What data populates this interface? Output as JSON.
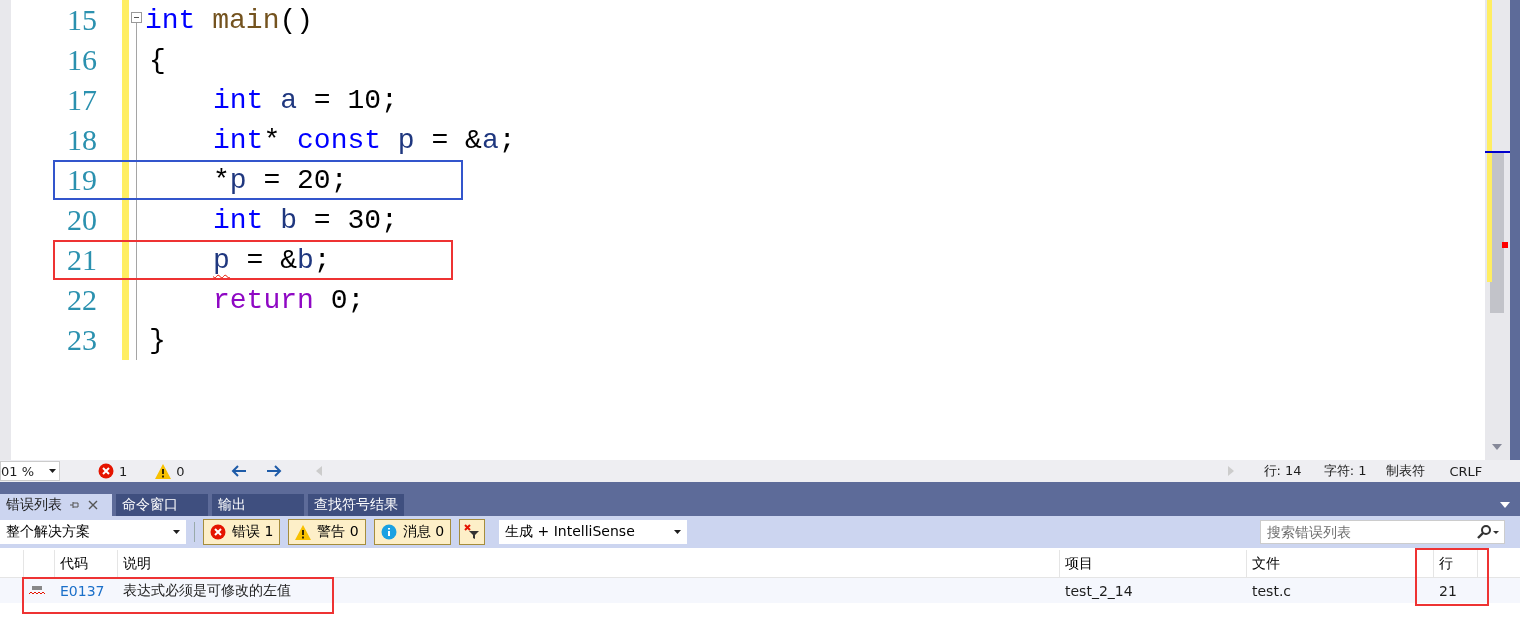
{
  "editor": {
    "lines": [
      {
        "number": "15",
        "kind": "signature",
        "foldable": true,
        "tokens": [
          {
            "kind": "keyword",
            "text": "int"
          },
          {
            "kind": "function",
            "text": " main"
          },
          {
            "kind": "plain",
            "text": "()"
          }
        ]
      },
      {
        "number": "16",
        "kind": "brace",
        "tokens": [
          {
            "kind": "plain",
            "text": "{"
          }
        ]
      },
      {
        "number": "17",
        "kind": "statement",
        "tokens": [
          {
            "kind": "keyword",
            "text": "int"
          },
          {
            "kind": "ident",
            "text": " a"
          },
          {
            "kind": "plain",
            "text": " = 10;"
          }
        ]
      },
      {
        "number": "18",
        "kind": "statement",
        "tokens": [
          {
            "kind": "keyword",
            "text": "int"
          },
          {
            "kind": "plain",
            "text": "* "
          },
          {
            "kind": "keyword",
            "text": "const"
          },
          {
            "kind": "ident",
            "text": " p"
          },
          {
            "kind": "plain",
            "text": " = &"
          },
          {
            "kind": "ident",
            "text": "a"
          },
          {
            "kind": "plain",
            "text": ";"
          }
        ]
      },
      {
        "number": "19",
        "kind": "statement",
        "color": "#3355cc",
        "tokens": [
          {
            "kind": "plain",
            "text": "*"
          },
          {
            "kind": "ident",
            "text": "p"
          },
          {
            "kind": "plain",
            "text": " = 20;"
          }
        ]
      },
      {
        "number": "20",
        "kind": "statement",
        "tokens": [
          {
            "kind": "keyword",
            "text": "int"
          },
          {
            "kind": "ident",
            "text": " b"
          },
          {
            "kind": "plain",
            "text": " = 30;"
          }
        ]
      },
      {
        "number": "21",
        "kind": "statement",
        "color": "#ee3333",
        "tokens": [
          {
            "kind": "ident",
            "text": "p",
            "error": true
          },
          {
            "kind": "plain",
            "text": " = &"
          },
          {
            "kind": "ident",
            "text": "b"
          },
          {
            "kind": "plain",
            "text": ";"
          }
        ]
      },
      {
        "number": "22",
        "kind": "statement",
        "tokens": [
          {
            "kind": "control",
            "text": "return"
          },
          {
            "kind": "plain",
            "text": " 0;"
          }
        ]
      },
      {
        "number": "23",
        "kind": "brace",
        "tokens": [
          {
            "kind": "plain",
            "text": "}"
          }
        ]
      }
    ]
  },
  "status_bar": {
    "zoom": "01 %",
    "errors": "1",
    "warnings": "0",
    "line": "行: 14",
    "char": "字符: 1",
    "indent": "制表符",
    "eol": "CRLF"
  },
  "tabs": [
    {
      "label": "错误列表",
      "selected": true
    },
    {
      "label": "命令窗口",
      "selected": false
    },
    {
      "label": "输出",
      "selected": false
    },
    {
      "label": "查找符号结果",
      "selected": false
    }
  ],
  "toolbar": {
    "scope": "整个解决方案",
    "filters": [
      {
        "kind": "error",
        "label": "错误 1",
        "selected": true
      },
      {
        "kind": "warning",
        "label": "警告 0",
        "selected": true
      },
      {
        "kind": "message",
        "label": "消息 0",
        "selected": true
      }
    ],
    "source": "生成 + IntelliSense",
    "search": {
      "placeholder": "搜索错误列表"
    }
  },
  "table": {
    "columns": [
      {
        "label": "代码"
      },
      {
        "label": "说明"
      },
      {
        "label": "项目"
      },
      {
        "label": "文件"
      },
      {
        "label": "行",
        "color": "#ee3333"
      }
    ],
    "rows": [
      {
        "code": "E0137",
        "description": "表达式必须是可修改的左值",
        "project": "test_2_14",
        "file": "test.c",
        "line": "21",
        "color": "#ee3333"
      }
    ]
  }
}
